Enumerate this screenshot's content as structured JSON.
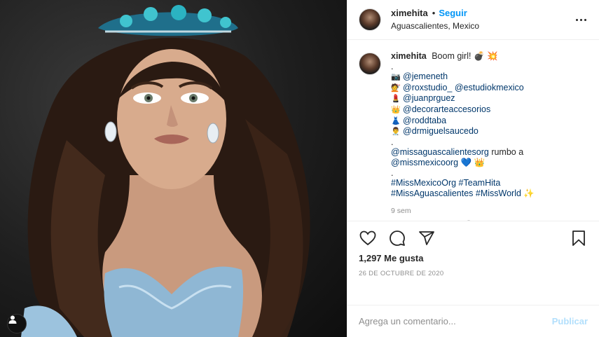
{
  "post": {
    "author": "ximehita",
    "follow_label": "Seguir",
    "dot": "•",
    "location": "Aguascalientes, Mexico"
  },
  "caption": {
    "username": "ximehita",
    "lines": [
      {
        "text": "Boom girl! 💣 💥",
        "kind": "text"
      },
      {
        "text": ".",
        "kind": "text"
      },
      {
        "emoji": "📷",
        "text": "@jemeneth",
        "kind": "mention"
      },
      {
        "emoji": "💇",
        "text": "@roxstudio_ @estudiokmexico",
        "kind": "mention"
      },
      {
        "emoji": "💄",
        "text": "@juanprguez",
        "kind": "mention"
      },
      {
        "emoji": "👑",
        "text": "@decorarteaccesorios",
        "kind": "mention"
      },
      {
        "emoji": "👗",
        "text": "@roddtaba",
        "kind": "mention"
      },
      {
        "emoji": "👨‍⚕️",
        "text": "@drmiguelsaucedo",
        "kind": "mention"
      },
      {
        "text": ".",
        "kind": "text"
      },
      {
        "prefix": "@missaguascalientesorg",
        "text": " rumbo a",
        "kind": "mixed"
      },
      {
        "prefix": "@missmexicoorg",
        "text": " 💙 👑",
        "kind": "mixed"
      },
      {
        "text": ".",
        "kind": "text"
      },
      {
        "text": "#MissMexicoOrg #TeamHita",
        "kind": "hashtag"
      },
      {
        "text": "#MissAguascalientes #MissWorld ✨",
        "kind": "hashtag"
      }
    ],
    "time_ago": "9 sem"
  },
  "actions": {
    "likes": "1,297 Me gusta",
    "date": "26 DE OCTUBRE DE 2020"
  },
  "comment_box": {
    "placeholder": "Agrega un comentario...",
    "publish_label": "Publicar"
  },
  "icons": {
    "like": "heart-icon",
    "comment": "comment-icon",
    "share": "share-icon",
    "save": "bookmark-icon",
    "more": "more-options-icon",
    "load_more": "plus-circle-icon",
    "user_tags": "user-icon"
  },
  "colors": {
    "link_blue": "#0095f6",
    "mention_blue": "#00376b",
    "muted": "#8e8e8e",
    "publish_disabled": "#b2dffc"
  }
}
